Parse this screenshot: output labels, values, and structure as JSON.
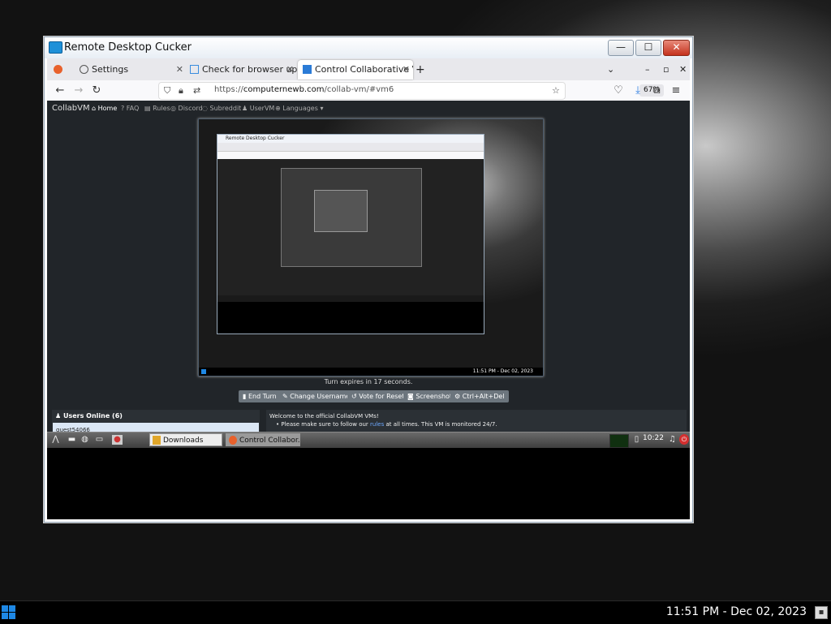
{
  "desktop": {
    "taskbar": {
      "clock": "11:51 PM - Dec 02, 2023"
    }
  },
  "rdp_window": {
    "title": "Remote Desktop Cucker",
    "buttons": {
      "minimize": "—",
      "maximize": "☐",
      "close": "✕"
    }
  },
  "browser": {
    "tabs": [
      {
        "label": "Settings",
        "active": false
      },
      {
        "label": "Check for browser upda",
        "active": false
      },
      {
        "label": "Control Collaborative Vi",
        "active": true
      }
    ],
    "new_tab": "+",
    "url_prefix": "https://",
    "url_domain": "computernewb.com",
    "url_path": "/collab-vm/#vm6",
    "zoom": "67%",
    "window_controls": {
      "list": "⌄",
      "minimize": "–",
      "restore": "▫",
      "close": "✕"
    }
  },
  "collabvm": {
    "brand": "CollabVM",
    "nav": [
      "Home",
      "FAQ",
      "Rules",
      "Discord",
      "Subreddit",
      "UserVM",
      "Languages"
    ],
    "vm_screen": {
      "inner_title": "Remote Desktop Cucker",
      "clock": "11:51 PM - Dec 02, 2023"
    },
    "turn_text": "Turn expires in 17 seconds.",
    "buttons": [
      "End Turn",
      "Change Username",
      "Vote for Reset",
      "Screenshot",
      "Ctrl+Alt+Del"
    ],
    "users_title": "Users Online (6)",
    "users": [
      "guest54066"
    ],
    "chat": {
      "welcome": "Welcome to the official CollabVM VMs!",
      "line2_prefix": "• Please make sure to follow our ",
      "line2_link": "rules",
      "line2_suffix": " at all times. This VM is monitored 24/7."
    }
  },
  "remote_taskbar": {
    "tasks": [
      "Downloads",
      "Control Collabor..."
    ],
    "clock": "10:22"
  },
  "colors": {
    "accent_blue": "#1e88e5",
    "close_red": "#c4321e",
    "page_dark": "#212529",
    "button_gray": "#6c757d"
  }
}
